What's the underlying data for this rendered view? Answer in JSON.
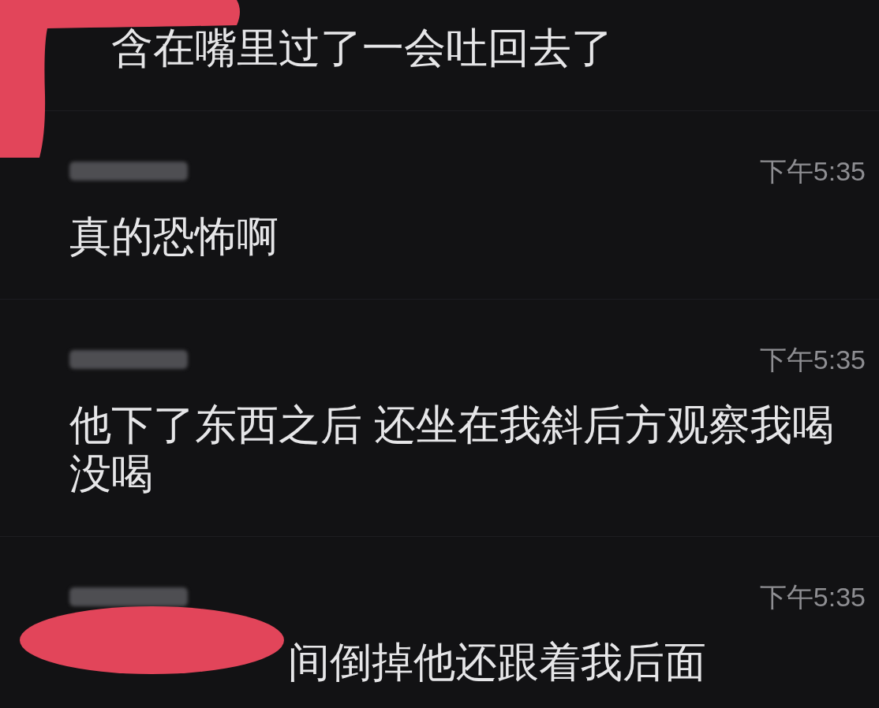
{
  "messages": [
    {
      "kind": "corner",
      "text": "含在嘴里过了一会吐回去了",
      "sender_blurred": false
    },
    {
      "kind": "plain",
      "time": "下午5:35",
      "text": "真的恐怖啊",
      "sender_blurred": true
    },
    {
      "kind": "plain",
      "time": "下午5:35",
      "text": "他下了东西之后 还坐在我斜后方观察我喝没喝",
      "sender_blurred": true
    },
    {
      "kind": "smear",
      "time": "下午5:35",
      "text": "间倒掉他还跟着我后面",
      "sender_blurred": true
    }
  ]
}
